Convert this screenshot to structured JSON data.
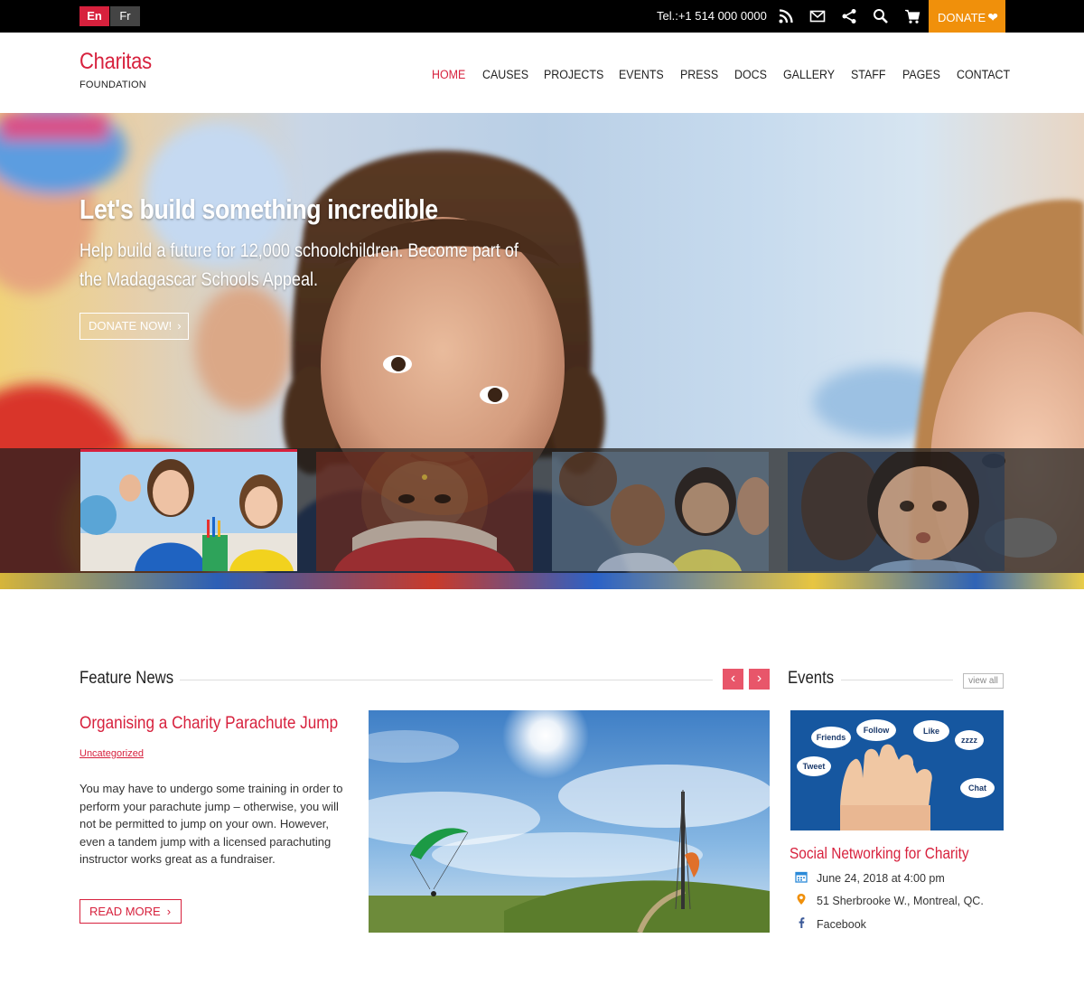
{
  "topbar": {
    "languages": [
      {
        "label": "En",
        "active": true
      },
      {
        "label": "Fr",
        "active": false
      }
    ],
    "phone": "Tel.:+1 514 000 0000",
    "icons": [
      "rss-icon",
      "mail-icon",
      "share-icon",
      "search-icon",
      "cart-icon"
    ],
    "donate_label": "DONATE",
    "donate_icon": "heart-icon",
    "donate_color": "#f0900b"
  },
  "header": {
    "logo_name": "Charitas",
    "logo_sub": "FOUNDATION",
    "brand_color": "#d7213d",
    "nav": [
      {
        "label": "HOME",
        "active": true
      },
      {
        "label": "CAUSES"
      },
      {
        "label": "PROJECTS"
      },
      {
        "label": "EVENTS"
      },
      {
        "label": "PRESS"
      },
      {
        "label": "DOCS"
      },
      {
        "label": "GALLERY"
      },
      {
        "label": "STAFF"
      },
      {
        "label": "PAGES"
      },
      {
        "label": "CONTACT"
      }
    ]
  },
  "hero": {
    "title": "Let's build something incredible",
    "subtitle": "Help build a future for 12,000 schoolchildren. Become part of the Madagascar Schools Appeal.",
    "button_label": "DONATE NOW!",
    "button_icon": "chevron-right-icon",
    "thumbnails": [
      {
        "name": "thumb-schoolgirls",
        "active": true
      },
      {
        "name": "thumb-woman-veil",
        "active": false
      },
      {
        "name": "thumb-children-group",
        "active": false
      },
      {
        "name": "thumb-toddler",
        "active": false
      }
    ]
  },
  "feature_news": {
    "section_title": "Feature News",
    "prev_icon": "chevron-left-icon",
    "next_icon": "chevron-right-icon",
    "article": {
      "title": "Organising a Charity Parachute Jump",
      "category": "Uncategorized",
      "excerpt": "You may have to undergo some training in order to perform your parachute jump – otherwise, you will not be permitted to jump on your own. However, even a tandem jump with a licensed parachuting instructor works great as a fundraiser.",
      "read_more_label": "READ MORE"
    }
  },
  "events": {
    "section_title": "Events",
    "view_all_label": "view all",
    "image_bubbles": [
      "Friends",
      "Follow",
      "Like",
      "zzzz",
      "Tweet",
      "Chat"
    ],
    "event": {
      "title": "Social Networking for Charity",
      "date": "June 24, 2018 at 4:00 pm",
      "location": "51 Sherbrooke W., Montreal, QC.",
      "link": "Facebook"
    }
  }
}
